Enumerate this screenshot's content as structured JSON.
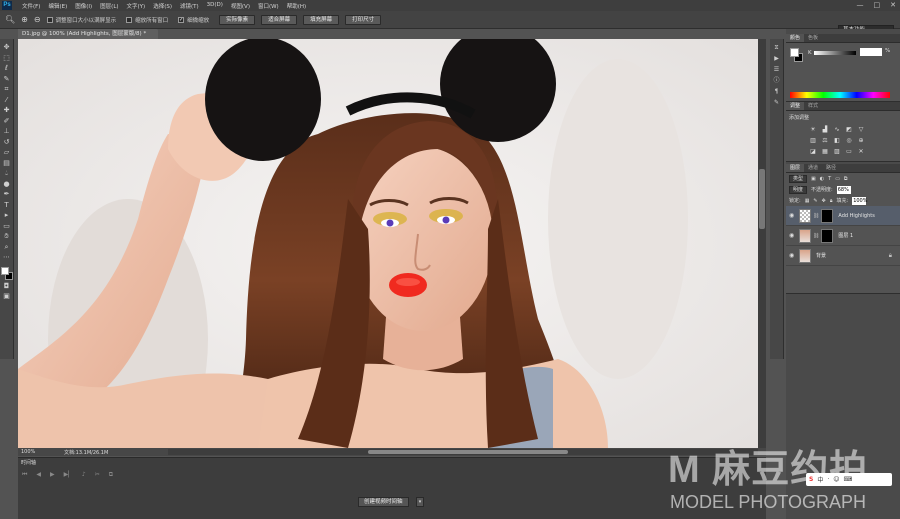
{
  "menubar": {
    "logo": "Ps",
    "items": [
      "文件(F)",
      "编辑(E)",
      "图像(I)",
      "图层(L)",
      "文字(Y)",
      "选择(S)",
      "滤镜(T)",
      "3D(D)",
      "视图(V)",
      "窗口(W)",
      "帮助(H)"
    ],
    "window_controls": [
      "—",
      "□",
      "✕"
    ]
  },
  "options": {
    "resize_windows": "调整窗口大小以满屏显示",
    "zoom_all": "缩放所有窗口",
    "scrubby_zoom": "细微缩放",
    "buttons": [
      "实际像素",
      "适合屏幕",
      "填充屏幕",
      "打印尺寸"
    ],
    "workspace": "基本功能"
  },
  "document": {
    "tab_title": "D1.jpg @ 100% (Add Highlights, 图层蒙版/8) *",
    "zoom": "100%",
    "doc_info": "文档:13.1M/26.1M"
  },
  "timeline": {
    "title": "时间轴",
    "create_button": "创建视频时间轴"
  },
  "color_panel": {
    "tabs": [
      "颜色",
      "色板"
    ],
    "channel": "K",
    "value": "",
    "unit": "%"
  },
  "adjustments_panel": {
    "tabs": [
      "调整",
      "样式"
    ],
    "label": "添加调整"
  },
  "layers_panel": {
    "tabs": [
      "图层",
      "通道",
      "路径"
    ],
    "filter": "类型",
    "blend_mode": "明度",
    "opacity_label": "不透明度:",
    "opacity": "68%",
    "lock_label": "锁定:",
    "fill_label": "填充:",
    "fill": "100%",
    "layers": [
      {
        "name": "Add Highlights",
        "selected": true
      },
      {
        "name": "图层 1",
        "selected": false
      },
      {
        "name": "背景",
        "selected": false
      }
    ]
  },
  "watermark": {
    "main": "M 麻豆约拍",
    "sub": "MODEL PHOTOGRAPH"
  },
  "ime_bar": [
    "S",
    "中",
    "·",
    "☺",
    "⌨"
  ],
  "colors": {
    "chrome": "#535353",
    "menubar": "#3e3e3e",
    "selected_layer": "#565e6b"
  }
}
